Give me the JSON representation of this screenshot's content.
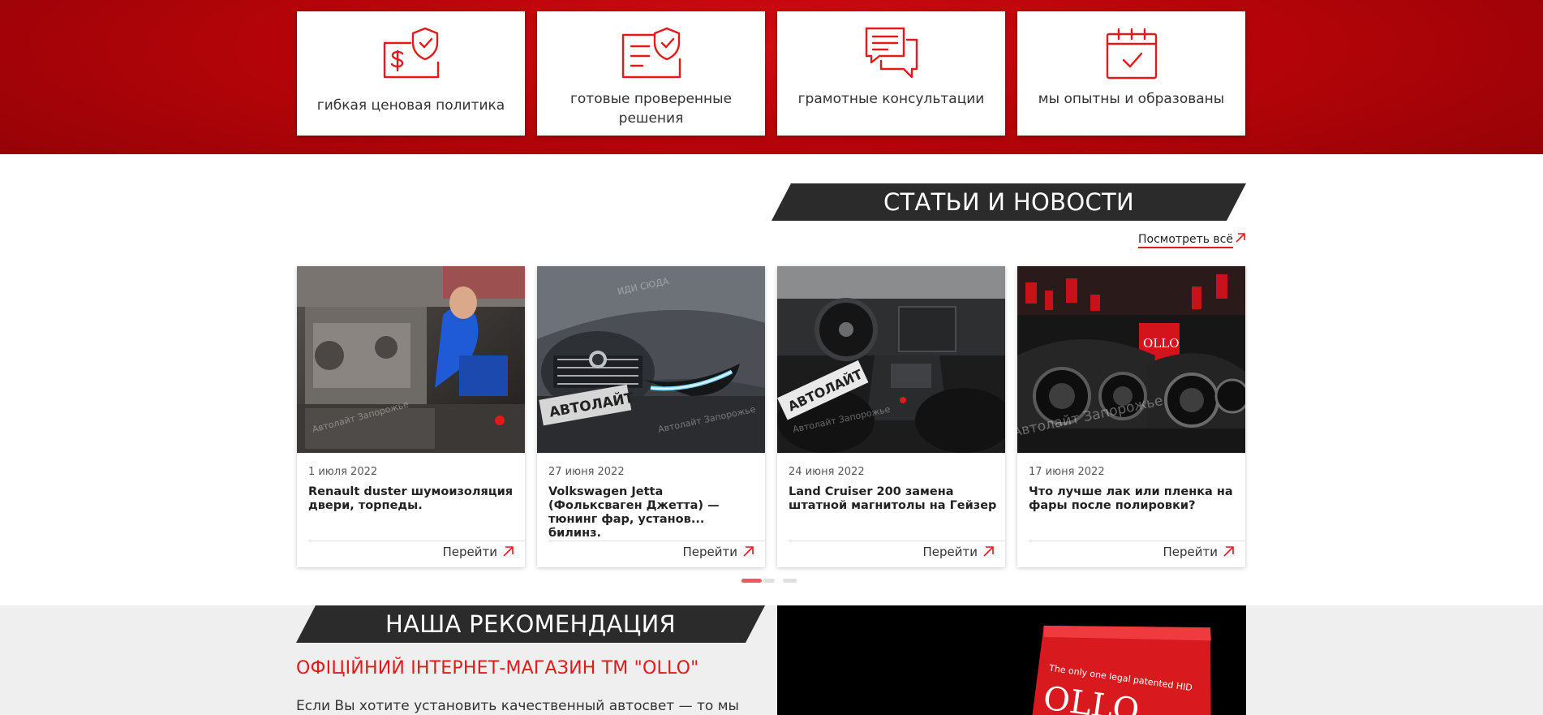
{
  "advantages": [
    {
      "label": "гибкая ценовая политика",
      "icon": "dollar-shield-icon"
    },
    {
      "label": "готовые проверенные решения",
      "icon": "document-shield-icon"
    },
    {
      "label": "грамотные консультации",
      "icon": "chat-bubbles-icon"
    },
    {
      "label": "мы опытны и образованы",
      "icon": "calendar-check-icon"
    }
  ],
  "news": {
    "title": "СТАТЬИ И НОВОСТИ",
    "view_all": "Посмотреть всё",
    "go_label": "Перейти",
    "items": [
      {
        "date": "1 июля 2022",
        "title": "Renault duster шумоизоляция двери, торпеды."
      },
      {
        "date": "27 июня 2022",
        "title": "Volkswagen Jetta (Фольксваген Джетта) — тюнинг фар, установ... билинз."
      },
      {
        "date": "24 июня 2022",
        "title": "Land Cruiser 200 замена штатной магнитолы на Гейзер"
      },
      {
        "date": "17 июня 2022",
        "title": "Что лучше лак или пленка на фары после полировки?"
      }
    ],
    "image_watermark": "Автолайт Запорожье",
    "image_plate": "АВТОЛАЙТ",
    "image_watermark_short": "ИДИ СЮДА",
    "image_box_text": "OLLO"
  },
  "recommendation": {
    "title": "НАША РЕКОМЕНДАЦИЯ",
    "heading": "ОФІЦІЙНИЙ ІНТЕРНЕТ-МАГАЗИН ТМ \"OLLO\"",
    "text": "Если Вы хотите установить качественный автосвет — то мы",
    "box_text_1": "The only one legal patented HID",
    "box_text_2": "OLLO"
  },
  "colors": {
    "accent": "#e21a1a",
    "band": "#b50409",
    "dark": "#2b2b2b"
  }
}
